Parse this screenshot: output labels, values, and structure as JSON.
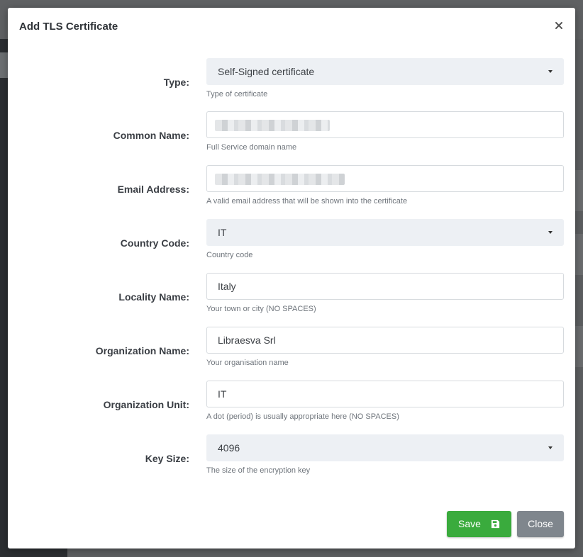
{
  "dialog": {
    "title": "Add TLS Certificate"
  },
  "fields": {
    "type": {
      "label": "Type:",
      "value": "Self-Signed certificate",
      "help": "Type of certificate"
    },
    "common_name": {
      "label": "Common Name:",
      "value": "",
      "help": "Full Service domain name"
    },
    "email": {
      "label": "Email Address:",
      "value": "",
      "help": "A valid email address that will be shown into the certificate"
    },
    "country": {
      "label": "Country Code:",
      "value": "IT",
      "help": "Country code"
    },
    "locality": {
      "label": "Locality Name:",
      "value": "Italy",
      "help": "Your town or city (NO SPACES)"
    },
    "organization": {
      "label": "Organization Name:",
      "value": "Libraesva Srl",
      "help": "Your organisation name"
    },
    "org_unit": {
      "label": "Organization Unit:",
      "value": "IT",
      "help": "A dot (period) is usually appropriate here (NO SPACES)"
    },
    "key_size": {
      "label": "Key Size:",
      "value": "4096",
      "help": "The size of the encryption key"
    }
  },
  "buttons": {
    "save_label": "Save",
    "close_label": "Close"
  },
  "icons": {
    "close": "close-icon",
    "save": "floppy-disk-icon",
    "dropdown": "caret-down-icon"
  },
  "colors": {
    "save_button": "#3aab3d",
    "close_button": "#7f868d",
    "select_background": "#edf0f4"
  }
}
